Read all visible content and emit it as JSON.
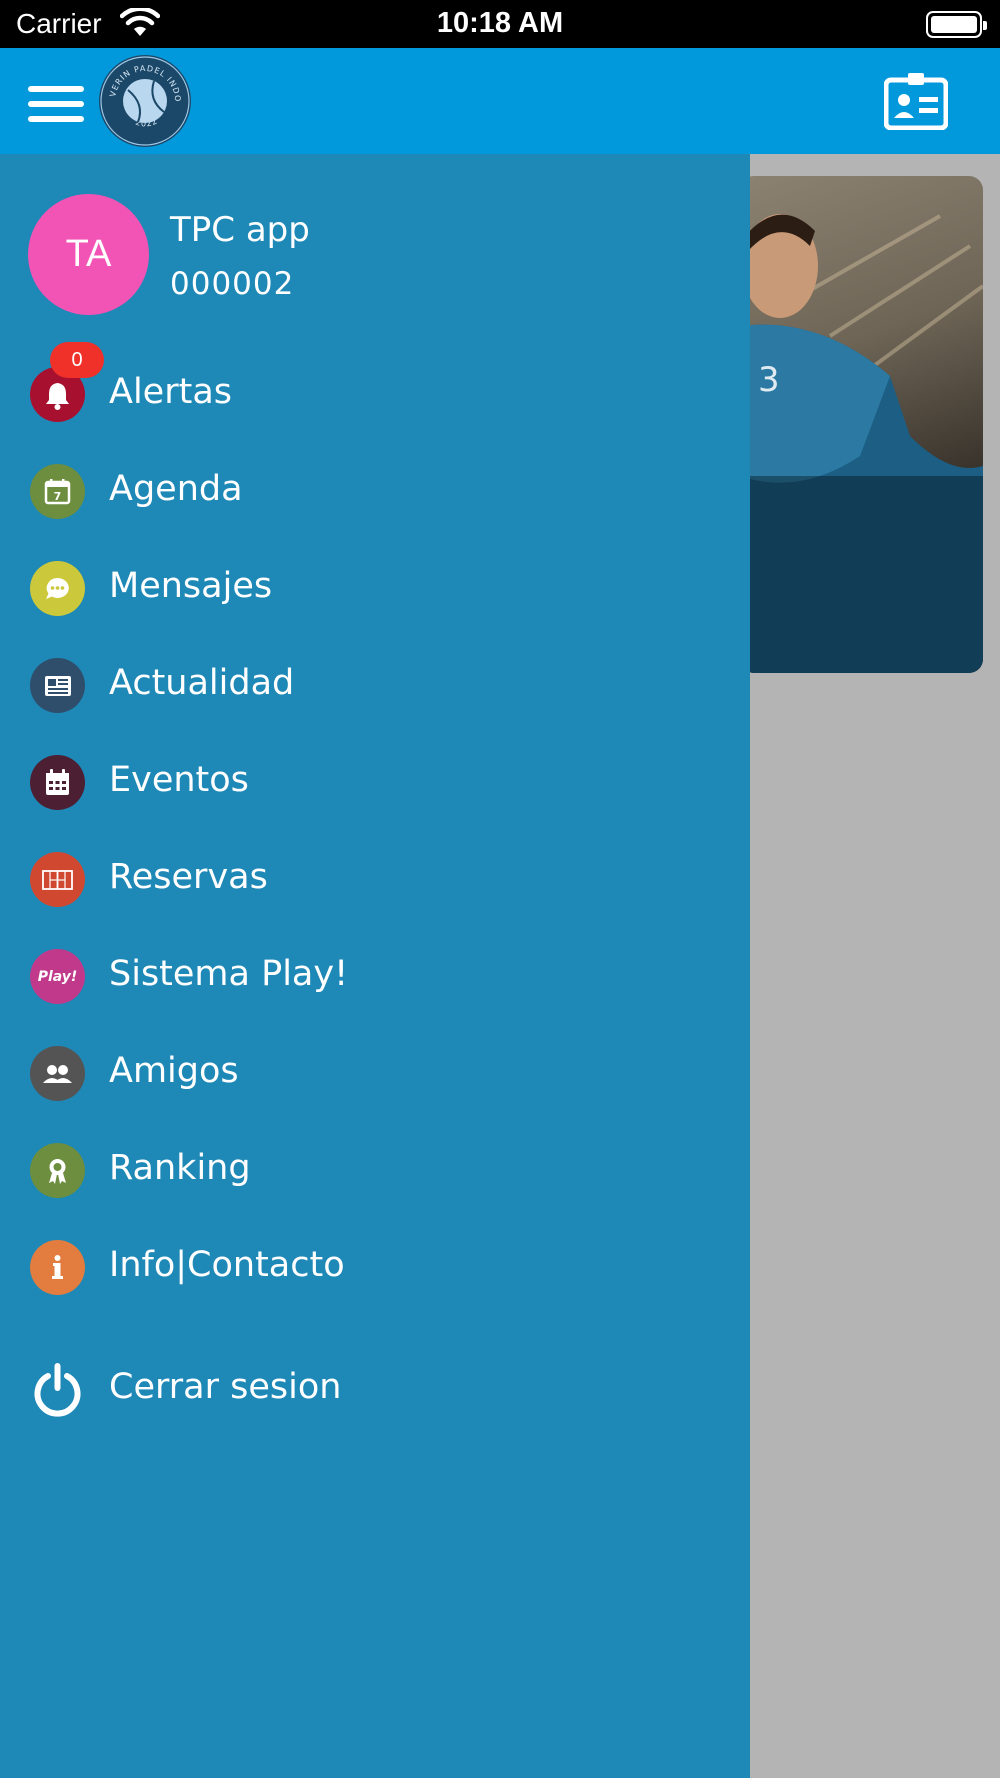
{
  "status_bar": {
    "carrier": "Carrier",
    "time": "10:18 AM"
  },
  "header": {
    "logo_text": "VERIN PADEL INDOOR",
    "logo_year": "2022"
  },
  "profile": {
    "initials": "TA",
    "name": "TPC app",
    "code": "000002"
  },
  "menu": {
    "alertas": {
      "label": "Alertas",
      "badge": "0",
      "color": "#a8102f",
      "icon": "bell-icon"
    },
    "agenda": {
      "label": "Agenda",
      "color": "#6c8e3e",
      "icon": "calendar-icon"
    },
    "mensajes": {
      "label": "Mensajes",
      "color": "#ccc83b",
      "icon": "chat-bubble-icon"
    },
    "actualidad": {
      "label": "Actualidad",
      "color": "#2e4e6b",
      "icon": "newspaper-icon"
    },
    "eventos": {
      "label": "Eventos",
      "color": "#4d1f33",
      "icon": "event-calendar-icon"
    },
    "reservas": {
      "label": "Reservas",
      "color": "#d0482f",
      "icon": "court-icon"
    },
    "sistema_play": {
      "label": "Sistema Play!",
      "color": "#c0398a",
      "icon": "play-logo-icon",
      "icon_text": "Play!"
    },
    "amigos": {
      "label": "Amigos",
      "color": "#545454",
      "icon": "friends-icon"
    },
    "ranking": {
      "label": "Ranking",
      "color": "#6c8e3e",
      "icon": "award-icon"
    },
    "info_contacto": {
      "label": "Info|Contacto",
      "color": "#e27d3f",
      "icon": "info-icon"
    },
    "cerrar_sesion": {
      "label": "Cerrar sesion",
      "icon": "power-icon"
    }
  }
}
